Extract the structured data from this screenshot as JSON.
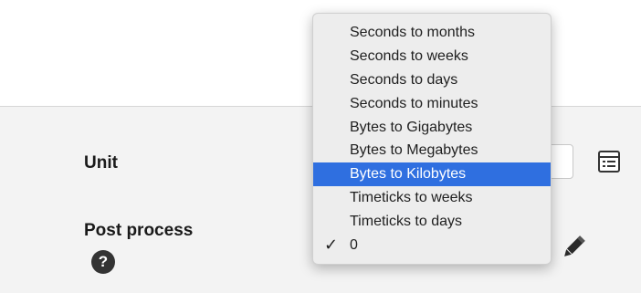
{
  "form": {
    "unit_label": "Unit",
    "post_process_label": "Post process",
    "help_symbol": "?"
  },
  "dropdown": {
    "items": [
      {
        "label": "Seconds to months"
      },
      {
        "label": "Seconds to weeks"
      },
      {
        "label": "Seconds to days"
      },
      {
        "label": "Seconds to minutes"
      },
      {
        "label": "Bytes to Gigabytes"
      },
      {
        "label": "Bytes to Megabytes"
      },
      {
        "label": "Bytes to Kilobytes",
        "highlighted": true
      },
      {
        "label": "Timeticks to weeks"
      },
      {
        "label": "Timeticks to days"
      },
      {
        "label": "0",
        "checked": true
      }
    ],
    "check_symbol": "✓",
    "highlight_color": "#2f6fe0"
  },
  "icons": {
    "table": "table-icon",
    "pencil": "pencil-icon",
    "help": "help-icon",
    "check": "checkmark-icon"
  }
}
